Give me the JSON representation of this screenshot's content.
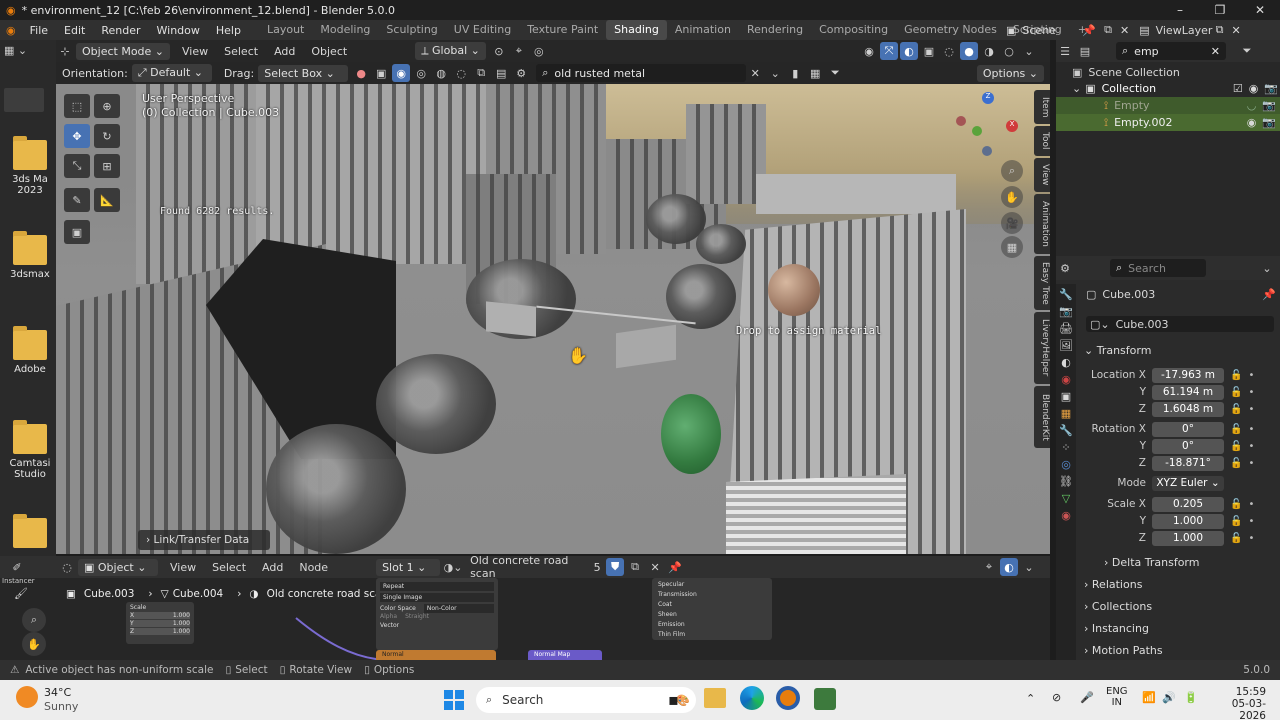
{
  "window": {
    "title": "* environment_12 [C:\\feb 26\\environment_12.blend] - Blender 5.0.0",
    "controls": [
      "–",
      "❐",
      "✕"
    ]
  },
  "menu": {
    "items": [
      "File",
      "Edit",
      "Render",
      "Window",
      "Help"
    ],
    "workspaces": [
      "Layout",
      "Modeling",
      "Sculpting",
      "UV Editing",
      "Texture Paint",
      "Shading",
      "Animation",
      "Rendering",
      "Compositing",
      "Geometry Nodes",
      "Scripting"
    ],
    "active_workspace": "Shading",
    "add_tab": "+",
    "scene": "Scene",
    "view_layer": "ViewLayer"
  },
  "desktop": {
    "items": [
      "3ds Ma 2023",
      "3dsmax",
      "Adobe",
      "Camtasi Studio"
    ]
  },
  "viewport_header": {
    "mode": "Object Mode",
    "menus": [
      "View",
      "Select",
      "Add",
      "Object"
    ],
    "transform": "Global",
    "orientation_label": "Orientation:",
    "orientation_value": "Default",
    "drag_label": "Drag:",
    "drag_value": "Select Box",
    "search_value": "old rusted metal",
    "options": "Options"
  },
  "viewport": {
    "perspective": "User Perspective",
    "collection": "(0) Collection | Cube.003",
    "found": "Found 6282 results.",
    "drop": "Drop to assign material",
    "link_panel": "Link/Transfer Data",
    "side_tabs": [
      "Item",
      "Tool",
      "View",
      "Animation",
      "Easy Tree",
      "LiveryHelper",
      "BlenderKit"
    ]
  },
  "outliner": {
    "search": "emp",
    "scene_collection": "Scene Collection",
    "collection": "Collection",
    "items": [
      "Empty",
      "Empty.002"
    ]
  },
  "properties": {
    "search_placeholder": "Search",
    "object_name": "Cube.003",
    "object_field": "Cube.003",
    "transform_header": "Transform",
    "location": {
      "label": "Location X",
      "x": "-17.963 m",
      "y": "61.194 m",
      "z": "1.6048 m"
    },
    "rotation": {
      "label": "Rotation X",
      "x": "0°",
      "y": "0°",
      "z": "-18.871°"
    },
    "mode_label": "Mode",
    "mode": "XYZ Euler",
    "scale": {
      "label": "Scale X",
      "x": "0.205",
      "y": "1.000",
      "z": "1.000"
    },
    "axis_y": "Y",
    "axis_z": "Z",
    "sections": [
      "Delta Transform",
      "Relations",
      "Collections",
      "Instancing",
      "Motion Paths"
    ]
  },
  "node_editor": {
    "type": "Object",
    "menus": [
      "View",
      "Select",
      "Add",
      "Node"
    ],
    "slot": "Slot 1",
    "material": "Old concrete road scan",
    "users": "5",
    "breadcrumb": [
      "Cube.003",
      "Cube.004",
      "Old concrete road scan"
    ],
    "instancer": "Instancer",
    "node_fields": [
      "Repeat",
      "Single Image",
      "Color Space",
      "Non-Color",
      "Alpha",
      "Straight",
      "Vector"
    ],
    "scale_vals": [
      "Scale",
      "X",
      "1.000",
      "Y",
      "1.000",
      "Z",
      "1.000"
    ],
    "bsdf_panels": [
      "Specular",
      "Transmission",
      "Coat",
      "Sheen",
      "Emission",
      "Thin Film"
    ],
    "node_normal": "Normal",
    "node_normal_map": "Normal Map"
  },
  "status": {
    "message": "Active object has non-uniform scale",
    "select": "Select",
    "rotate": "Rotate View",
    "options": "Options",
    "version": "5.0.0"
  },
  "taskbar": {
    "temp": "34°C",
    "weather": "Sunny",
    "search": "Search",
    "lang1": "ENG",
    "lang2": "IN",
    "time": "15:59",
    "date": "05-03-2026"
  }
}
